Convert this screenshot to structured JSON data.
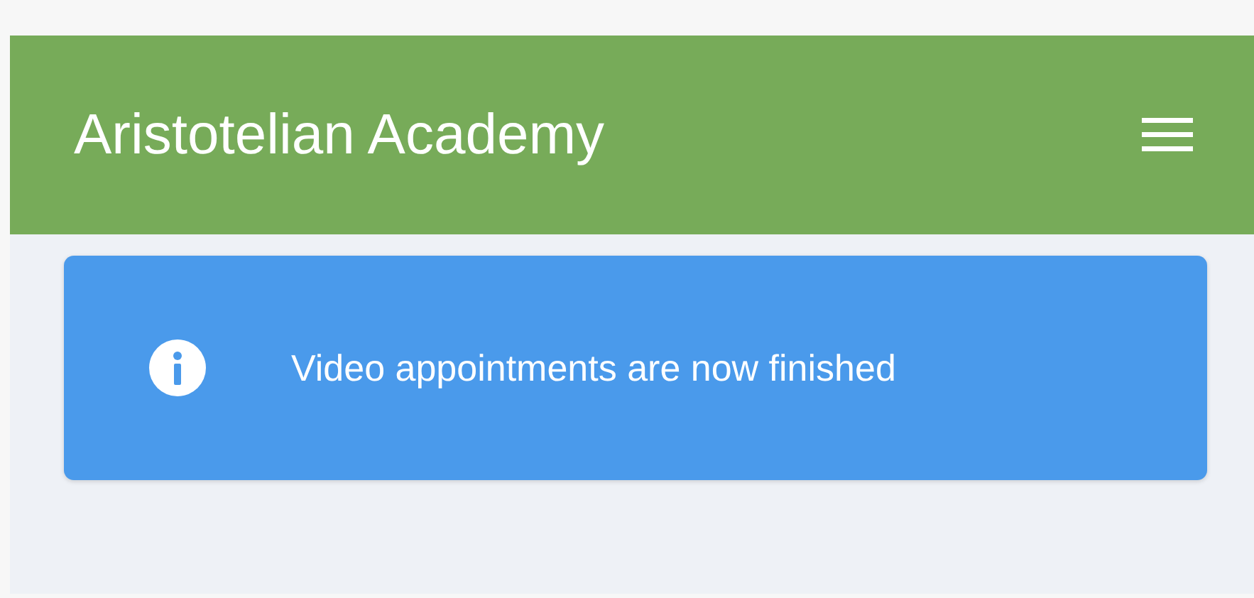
{
  "header": {
    "title": "Aristotelian Academy"
  },
  "alert": {
    "kind": "info",
    "message": "Video appointments are now finished"
  }
}
